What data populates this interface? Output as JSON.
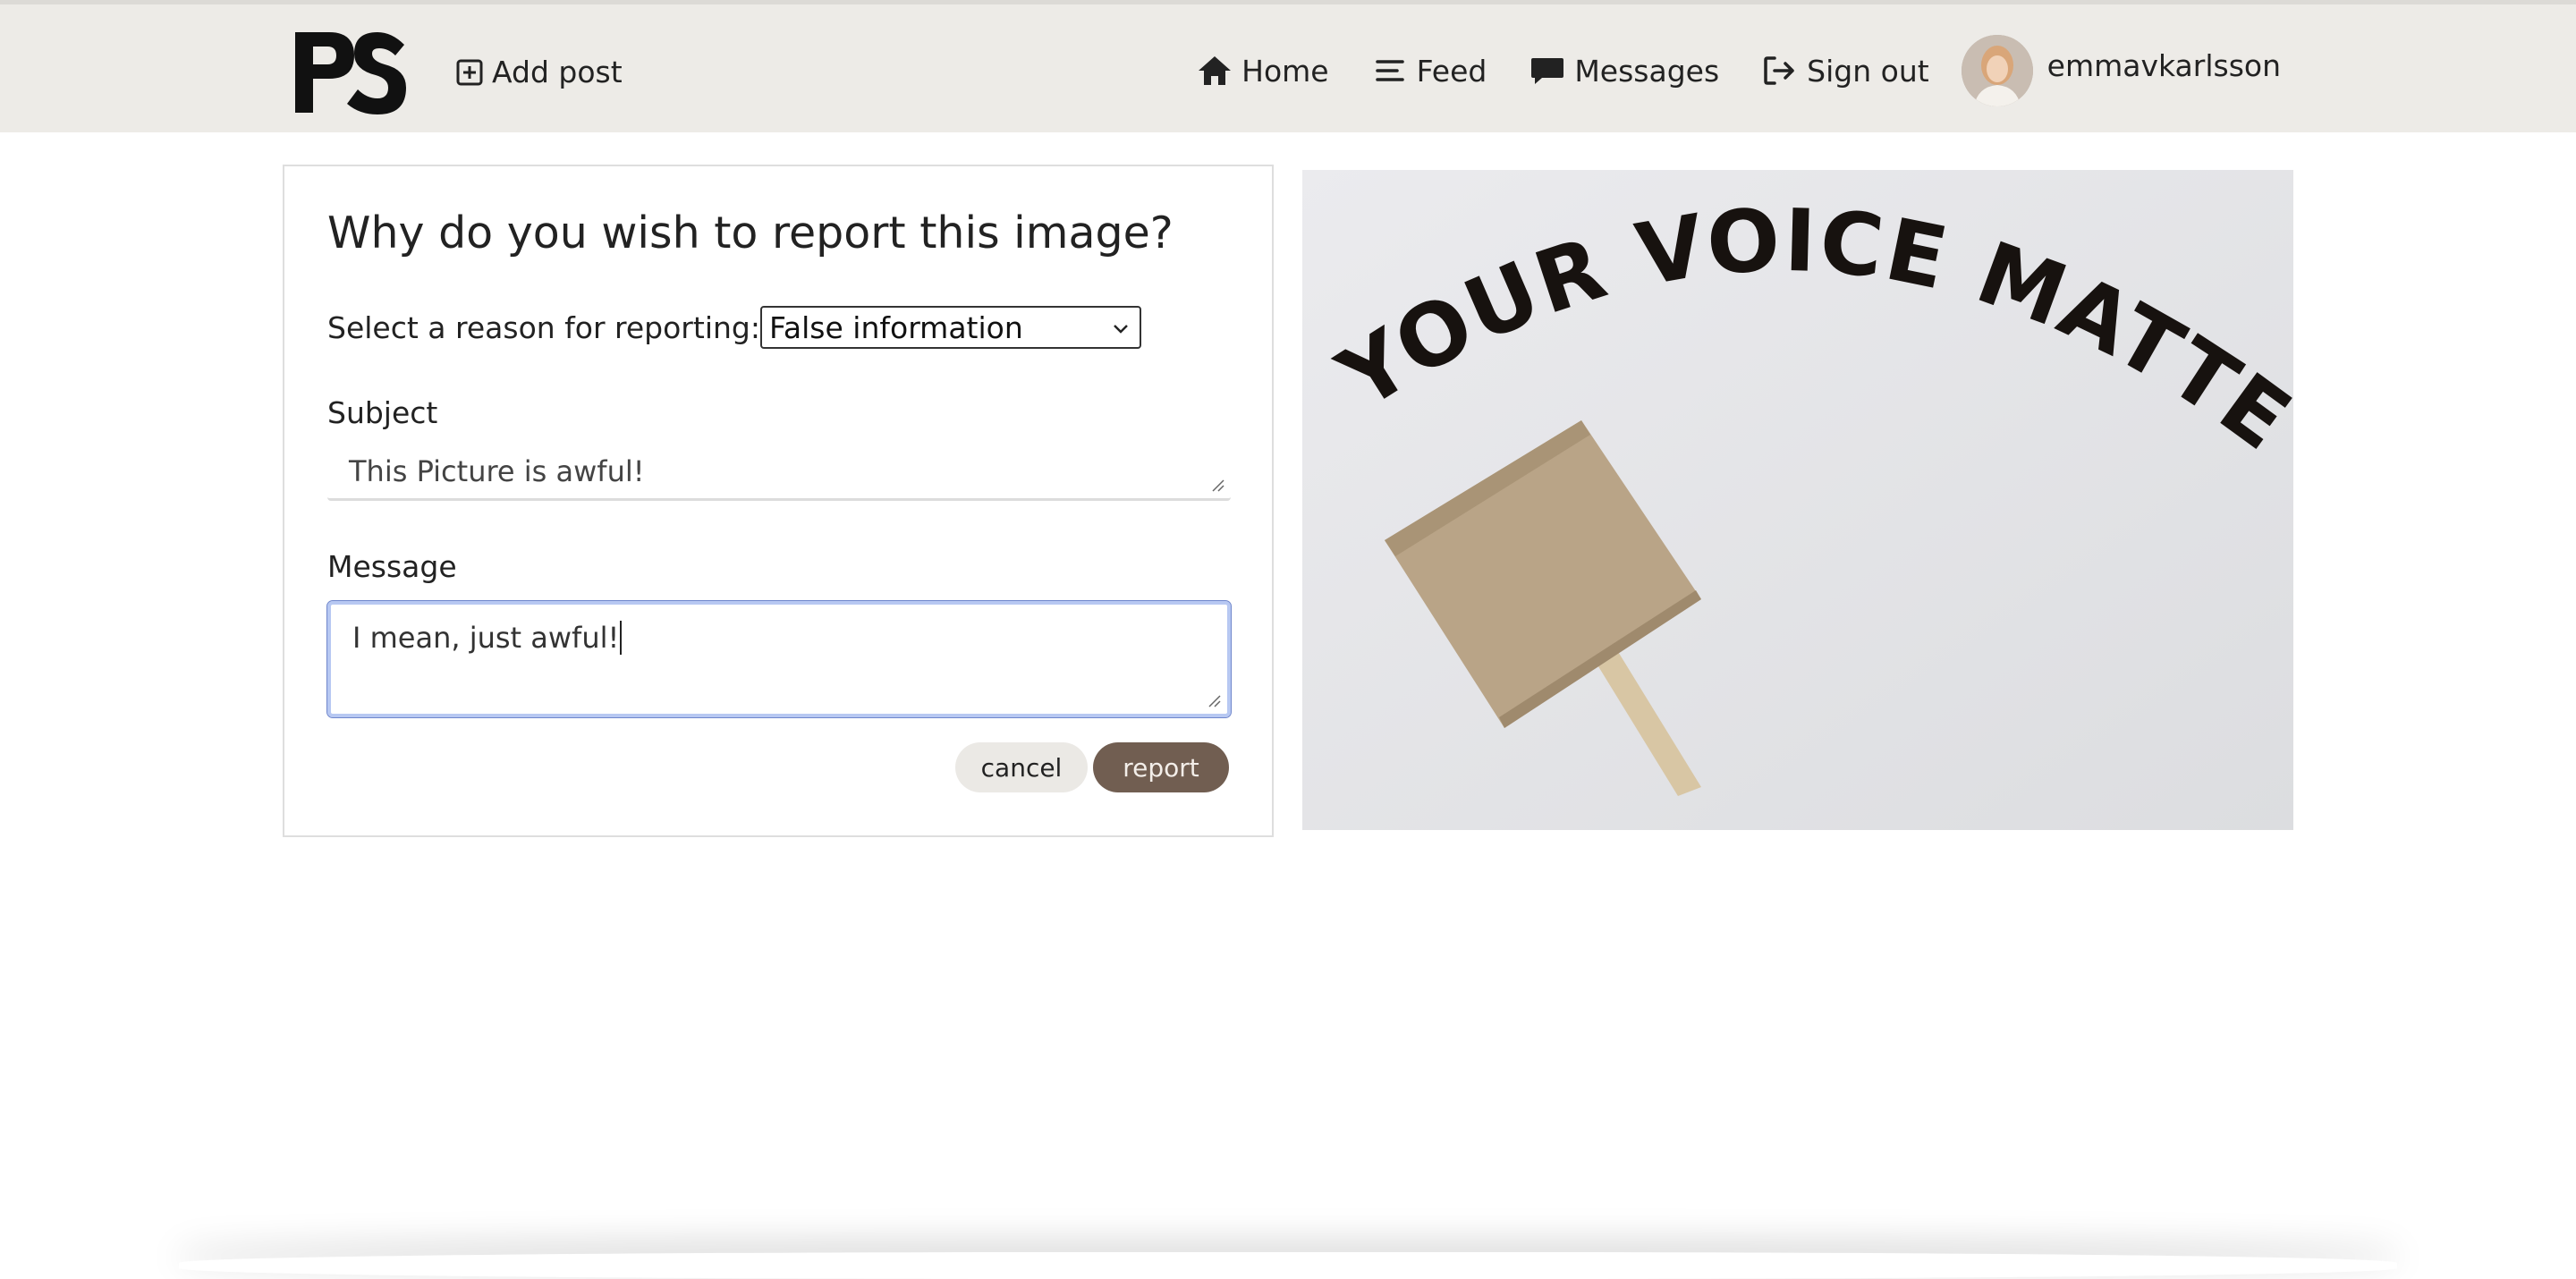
{
  "navbar": {
    "logo_text": "PS",
    "add_post": "Add post",
    "home": "Home",
    "feed": "Feed",
    "messages": "Messages",
    "sign_out": "Sign out",
    "username": "emmavkarlsson"
  },
  "report_form": {
    "title": "Why do you wish to report this image?",
    "reason_label": "Select a reason for reporting:",
    "reason_selected": "False information",
    "subject_label": "Subject",
    "subject_value": "This Picture is awful!",
    "message_label": "Message",
    "message_value": "I mean, just awful!",
    "cancel_label": "cancel",
    "report_label": "report"
  },
  "image": {
    "sign_text": "YOUR VOICE MATTERS"
  },
  "colors": {
    "navbar_bg": "#edebe7",
    "report_button": "#715e51",
    "cancel_button": "#ebe9e5",
    "focus_border": "#b7c8f2"
  }
}
